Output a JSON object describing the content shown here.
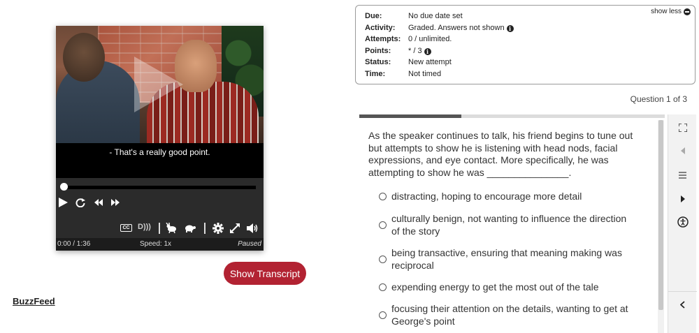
{
  "player": {
    "caption": "- That's a really good point.",
    "elapsed": "0:00 / 1:36",
    "speed": "Speed: 1x",
    "state": "Paused",
    "cc_label": "CC",
    "ad_label": "D",
    "progress_fraction": 0
  },
  "transcript_button": "Show Transcript",
  "source": "BuzzFeed",
  "info": {
    "show_less": "show less",
    "rows": [
      {
        "key": "Due:",
        "value": "No due date set",
        "info_icon": false
      },
      {
        "key": "Activity:",
        "value": "Graded. Answers not shown",
        "info_icon": true
      },
      {
        "key": "Attempts:",
        "value": "0 / unlimited.",
        "info_icon": false
      },
      {
        "key": "Points:",
        "value": "* / 3",
        "info_icon": true
      },
      {
        "key": "Status:",
        "value": "New attempt",
        "info_icon": false
      },
      {
        "key": "Time:",
        "value": "Not timed",
        "info_icon": false
      }
    ]
  },
  "question_counter": "Question 1 of 3",
  "question": {
    "progress_fraction": 0.333,
    "text": "As the speaker continues to talk, his friend begins to tune out but attempts to show he is listening with head nods, facial expressions, and eye contact. More specifically, he was attempting to show he was _______________.",
    "options": [
      "distracting, hoping to encourage more detail",
      "culturally benign, not wanting to influence the direction of the story",
      "being transactive, ensuring that meaning making was reciprocal",
      "expending energy to get the most out of the tale",
      "focusing their attention on the details, wanting to get at George's point"
    ]
  },
  "rail_icons": [
    "fullscreen-icon",
    "prev-icon",
    "menu-icon",
    "next-icon",
    "accessibility-icon",
    "collapse-icon"
  ]
}
